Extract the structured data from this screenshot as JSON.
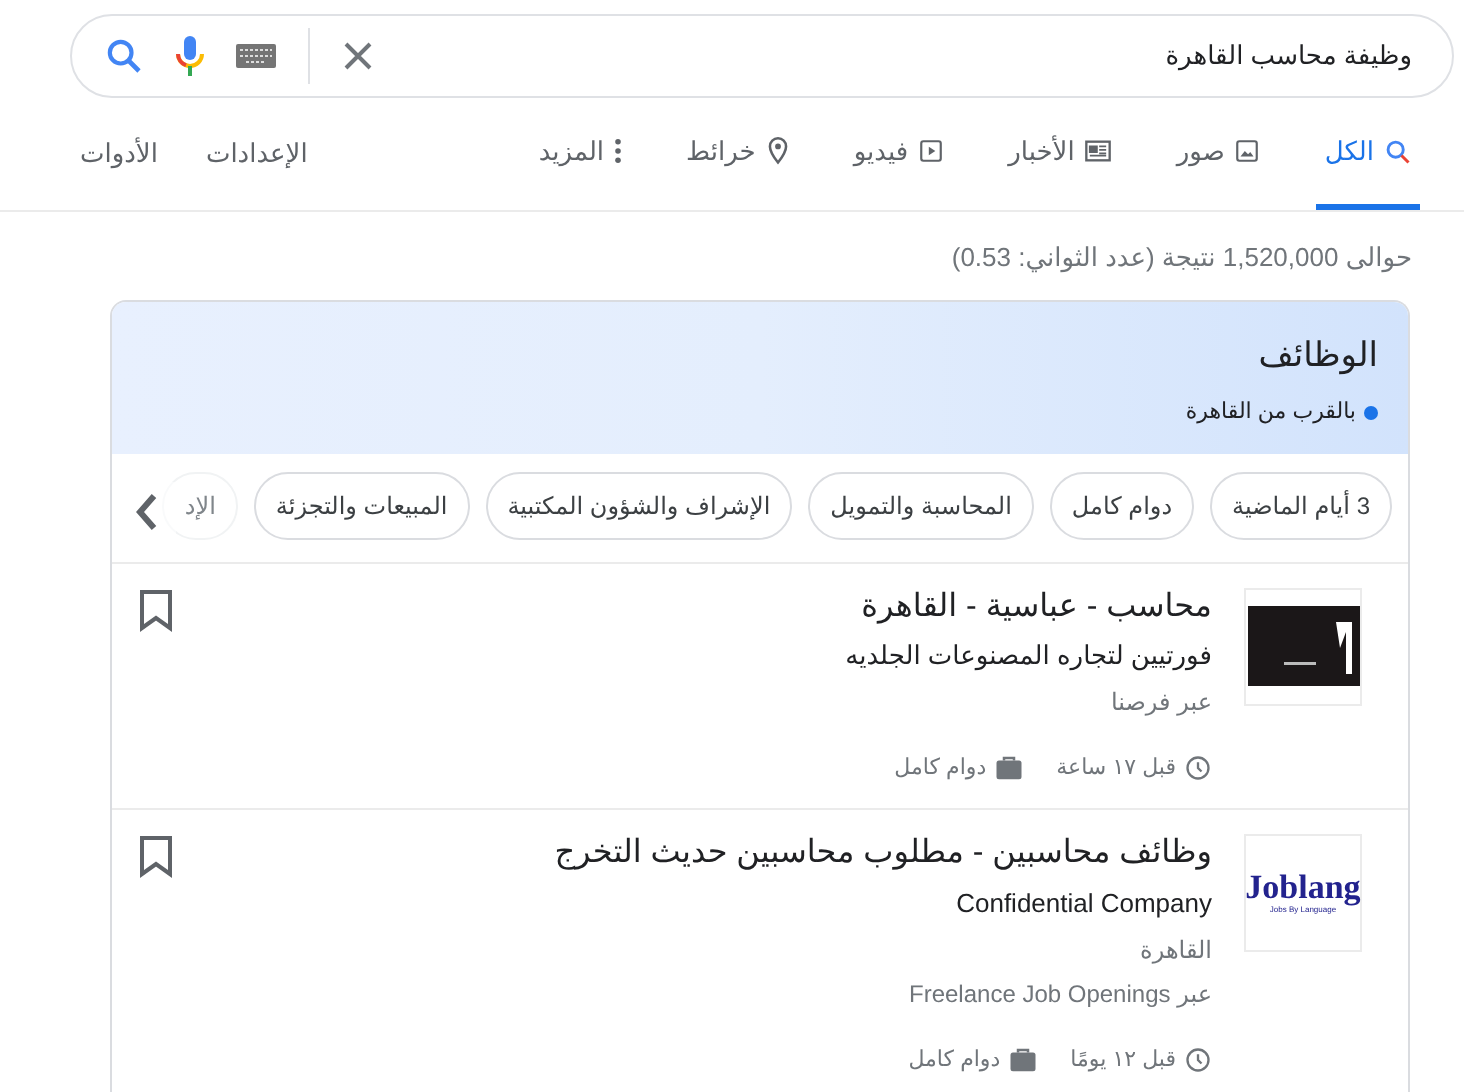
{
  "search": {
    "query": "وظيفة محاسب القاهرة"
  },
  "tabs": [
    {
      "label": "الكل",
      "selected": true
    },
    {
      "label": "صور",
      "selected": false
    },
    {
      "label": "الأخبار",
      "selected": false
    },
    {
      "label": "فيديو",
      "selected": false
    },
    {
      "label": "خرائط",
      "selected": false
    },
    {
      "label": "المزيد",
      "selected": false
    }
  ],
  "tools": [
    "الإعدادات",
    "الأدوات"
  ],
  "result_stats": "حوالى 1,520,000 نتيجة (عدد الثواني: 0.53)",
  "jobs_card": {
    "title": "الوظائف",
    "location": "بالقرب من القاهرة",
    "filters": [
      {
        "label": "3 أيام الماضية",
        "faded": false
      },
      {
        "label": "دوام كامل",
        "faded": false
      },
      {
        "label": "المحاسبة والتمويل",
        "faded": false
      },
      {
        "label": "الإشراف والشؤون المكتبية",
        "faded": false
      },
      {
        "label": "المبيعات والتجزئة",
        "faded": false
      },
      {
        "label": "الإد",
        "faded": true
      }
    ],
    "listings": [
      {
        "title": "محاسب - عباسية - القاهرة",
        "company": "فورتيين لتجاره المصنوعات الجلديه",
        "source": "عبر فرصنا",
        "posted": "قبل ١٧ ساعة",
        "type": "دوام كامل",
        "logo": {
          "kind": "dark"
        }
      },
      {
        "title": "وظائف محاسبين - مطلوب محاسبين حديث التخرج",
        "company": "Confidential Company",
        "location": "القاهرة",
        "source": "عبر Freelance Job Openings",
        "posted": "قبل ١٢ يومًا",
        "type": "دوام كامل",
        "logo": {
          "kind": "wordmark",
          "text": "Joblang",
          "tagline": "Jobs By Language"
        }
      }
    ]
  }
}
